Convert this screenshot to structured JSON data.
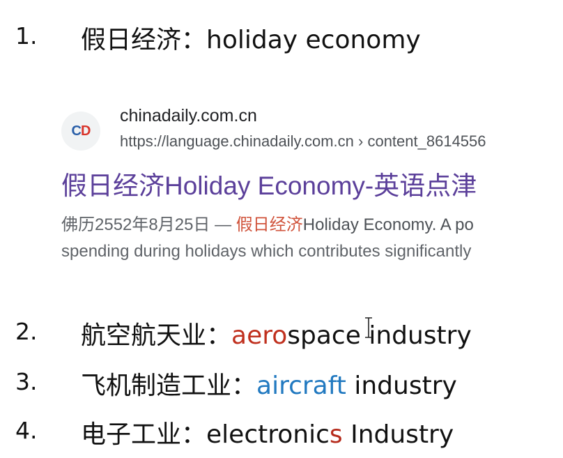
{
  "items": [
    {
      "number": "1.",
      "chinese": "假日经济：",
      "english": "holiday economy"
    },
    {
      "number": "2.",
      "chinese": "航空航天业：",
      "english_red": "aero",
      "english_rest": "space industry"
    },
    {
      "number": "3.",
      "chinese": "飞机制造工业：",
      "english_blue": "aircraft",
      "english_rest": " industry"
    },
    {
      "number": "4.",
      "chinese": "电子工业：",
      "english_pre": "electronic",
      "english_red": "s",
      "english_rest": " Industry"
    }
  ],
  "search_result": {
    "favicon_c": "C",
    "favicon_d": "D",
    "site_name": "chinadaily.com.cn",
    "url": "https://language.chinadaily.com.cn › content_8614556",
    "title": "假日经济Holiday Economy-英语点津",
    "snippet_date": "佛历2552年8月25日 — ",
    "snippet_highlight": "假日经济",
    "snippet_rest": "Holiday Economy. A po",
    "snippet_line2": "spending during holidays which contributes significantly"
  },
  "colors": {
    "red": "#c0301e",
    "blue": "#2179c0",
    "link_purple": "#5b3f9a"
  }
}
